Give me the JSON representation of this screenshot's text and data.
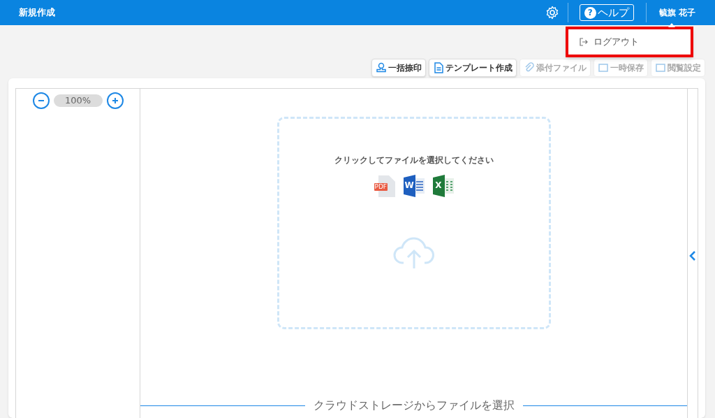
{
  "header": {
    "title": "新規作成",
    "help_icon": "?",
    "help_label": "ヘルプ",
    "user_name": "毓旗 花子"
  },
  "user_menu": {
    "expanded": true,
    "items": [
      {
        "label": "ログアウト",
        "highlighted": true
      }
    ]
  },
  "toolbar": [
    {
      "label": "一括捺印",
      "kind": "stamp",
      "disabled": false
    },
    {
      "label": "テンプレート作成",
      "kind": "document",
      "disabled": false
    },
    {
      "label": "添付ファイル",
      "kind": "clip",
      "disabled": true
    },
    {
      "label": "一時保存",
      "kind": "save",
      "disabled": true
    },
    {
      "label": "閲覧設定",
      "kind": "view",
      "disabled": true
    }
  ],
  "zoom": {
    "value": "100%"
  },
  "dropzone": {
    "prompt": "クリックしてファイルを選択してください",
    "file_types": [
      {
        "kind": "pdf",
        "label": "PDF"
      },
      {
        "kind": "word",
        "label": "W"
      },
      {
        "kind": "excel",
        "label": "X"
      }
    ]
  },
  "cloud_storage": {
    "label": "クラウドストレージからファイルを選択"
  }
}
